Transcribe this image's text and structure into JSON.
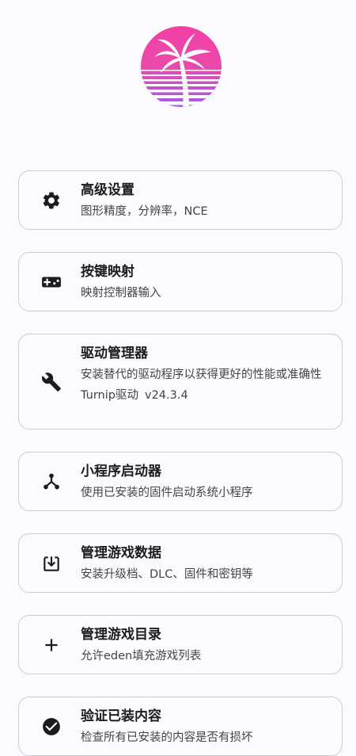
{
  "menu": {
    "advanced_settings": {
      "icon": "gear-icon",
      "title": "高级设置",
      "description": "图形精度，分辨率，NCE"
    },
    "input_mapping": {
      "icon": "gamepad-icon",
      "title": "按键映射",
      "description": "映射控制器输入"
    },
    "driver_manager": {
      "icon": "wrench-icon",
      "title": "驱动管理器",
      "description": "安装替代的驱动程序以获得更好的性能或准确性",
      "driver_name": "Turnip驱动",
      "driver_version": "v24.3.4"
    },
    "applet_launcher": {
      "icon": "applet-icon",
      "title": "小程序启动器",
      "description": "使用已安装的固件启动系统小程序"
    },
    "manage_game_data": {
      "icon": "install-icon",
      "title": "管理游戏数据",
      "description": "安装升级档、DLC、固件和密钥等"
    },
    "game_directories": {
      "icon": "add-icon",
      "title": "管理游戏目录",
      "description": "允许eden填充游戏列表"
    },
    "verify_contents": {
      "icon": "check-circle-icon",
      "title": "验证已装内容",
      "description": "检查所有已安装的内容是否有损坏"
    }
  },
  "colors": {
    "logo_top": "#f43fa7",
    "logo_bottom": "#a35af0",
    "border": "#cfcbd4",
    "icon": "#1c1b1f"
  }
}
